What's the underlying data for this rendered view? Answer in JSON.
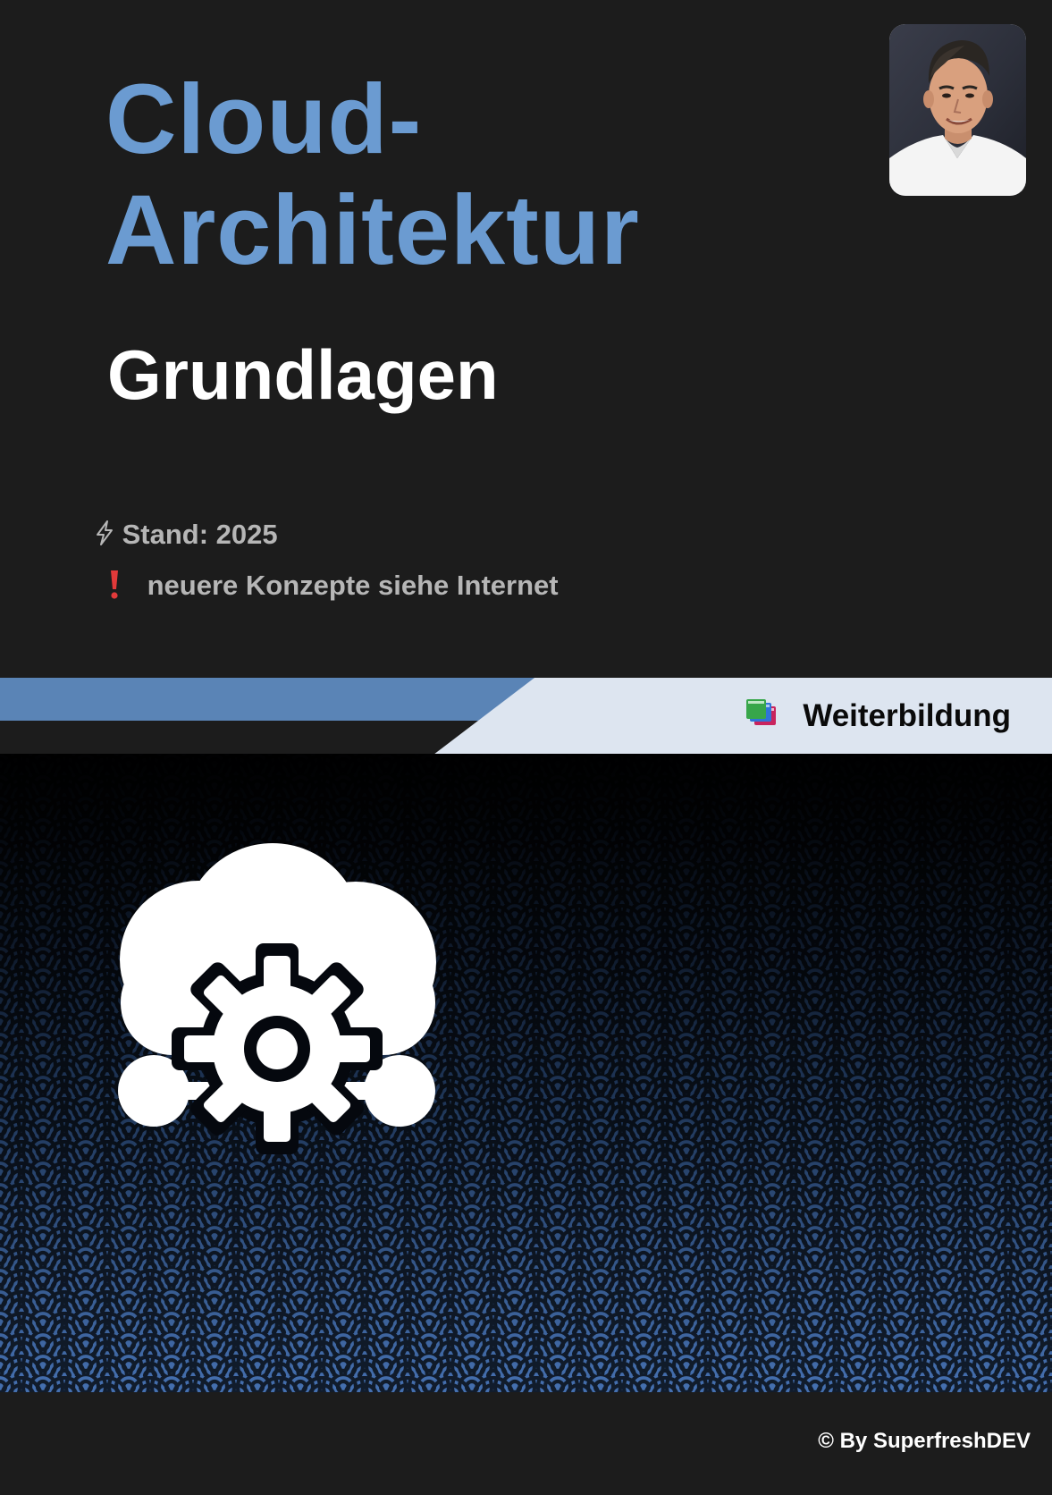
{
  "cover": {
    "title_line1": "Cloud-",
    "title_line2": "Architektur",
    "subtitle": "Grundlagen",
    "stand_label": "Stand: 2025",
    "note_label": "neuere Konzepte siehe Internet",
    "category_label": "Weiterbildung",
    "footer": "© By SuperfreshDEV"
  },
  "icons": {
    "stand": "lightning-bolt-icon",
    "note": "exclamation-mark-icon",
    "category": "books-icon",
    "main": "cloud-gear-network-icon"
  },
  "colors": {
    "background": "#1c1c1c",
    "title": "#6b9bd1",
    "banner_blue": "#5a84b6",
    "banner_light": "#dde5f0",
    "pattern_dark": "#05080e",
    "pattern_light": "#3b639c",
    "exclamation": "#e23a3a"
  }
}
